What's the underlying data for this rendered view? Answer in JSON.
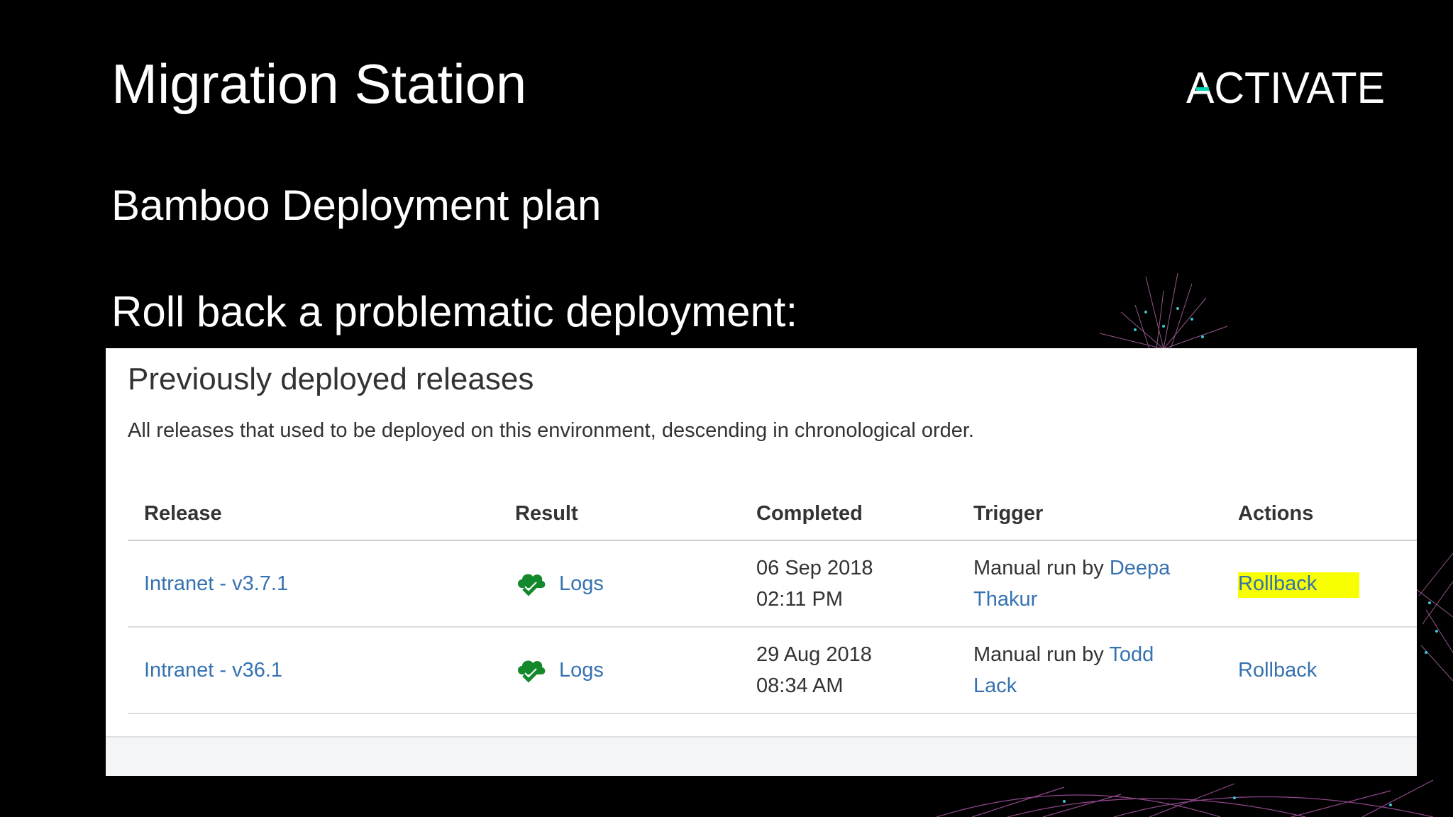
{
  "slide": {
    "title": "Migration Station",
    "subtitle": "Bamboo Deployment plan",
    "step": "Roll back a problematic deployment:",
    "logo_text": "ACTIVATE",
    "logo_accent_color": "#00d1b2"
  },
  "panel": {
    "title": "Previously deployed releases",
    "description": "All releases that used to be deployed on this environment, descending in chronological order.",
    "columns": [
      "Release",
      "Result",
      "Completed",
      "Trigger",
      "Actions"
    ],
    "rows": [
      {
        "release": "Intranet - v3.7.1",
        "result_icon": "success-cloud-check-icon",
        "result_link": "Logs",
        "completed_date": "06 Sep 2018",
        "completed_time": "02:11 PM",
        "trigger_prefix": "Manual run by",
        "trigger_user_first": "Deepa",
        "trigger_user_last": "Thakur",
        "action": "Rollback",
        "highlighted": true
      },
      {
        "release": "Intranet - v36.1",
        "result_icon": "success-cloud-check-icon",
        "result_link": "Logs",
        "completed_date": "29 Aug 2018",
        "completed_time": "08:34 AM",
        "trigger_prefix": "Manual run by",
        "trigger_user_first": "Todd",
        "trigger_user_last": "Lack",
        "action": "Rollback",
        "highlighted": false
      }
    ]
  },
  "colors": {
    "link": "#3572b0",
    "success": "#14892c",
    "highlight": "#f7ff00"
  }
}
